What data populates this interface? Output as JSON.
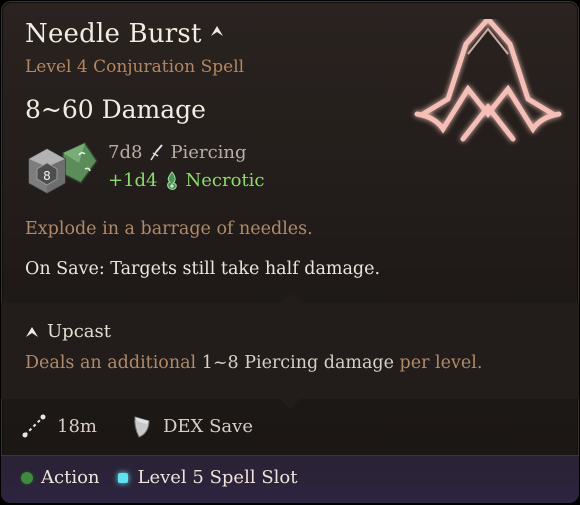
{
  "spell": {
    "name": "Needle Burst",
    "subtitle": "Level 4 Conjuration Spell",
    "damage": "8~60 Damage",
    "die_face": "8",
    "damage_lines": [
      {
        "dice": "7d8",
        "type": "Piercing"
      },
      {
        "dice": "+1d4",
        "type": "Necrotic"
      }
    ],
    "description": "Explode in a barrage of needles.",
    "on_save": "On Save: Targets still take half damage."
  },
  "upcast": {
    "label": "Upcast",
    "text_prefix": "Deals an additional",
    "text_value": "1~8 Piercing damage",
    "text_suffix": "per level."
  },
  "stats": {
    "range": "18m",
    "save": "DEX Save"
  },
  "cost": {
    "action": "Action",
    "slot": "Level 5 Spell Slot"
  },
  "colors": {
    "title": "#f3ece2",
    "subtitle": "#b48763",
    "necrotic": "#8bdc6a",
    "footer": "#2d2440",
    "emblem": "#ffc9c0"
  },
  "icons": [
    "upcast-chevron-icon",
    "dice-icon",
    "piercing-icon",
    "necrotic-icon",
    "range-icon",
    "shield-save-icon",
    "action-icon",
    "spell-slot-icon",
    "spell-emblem-icon"
  ]
}
